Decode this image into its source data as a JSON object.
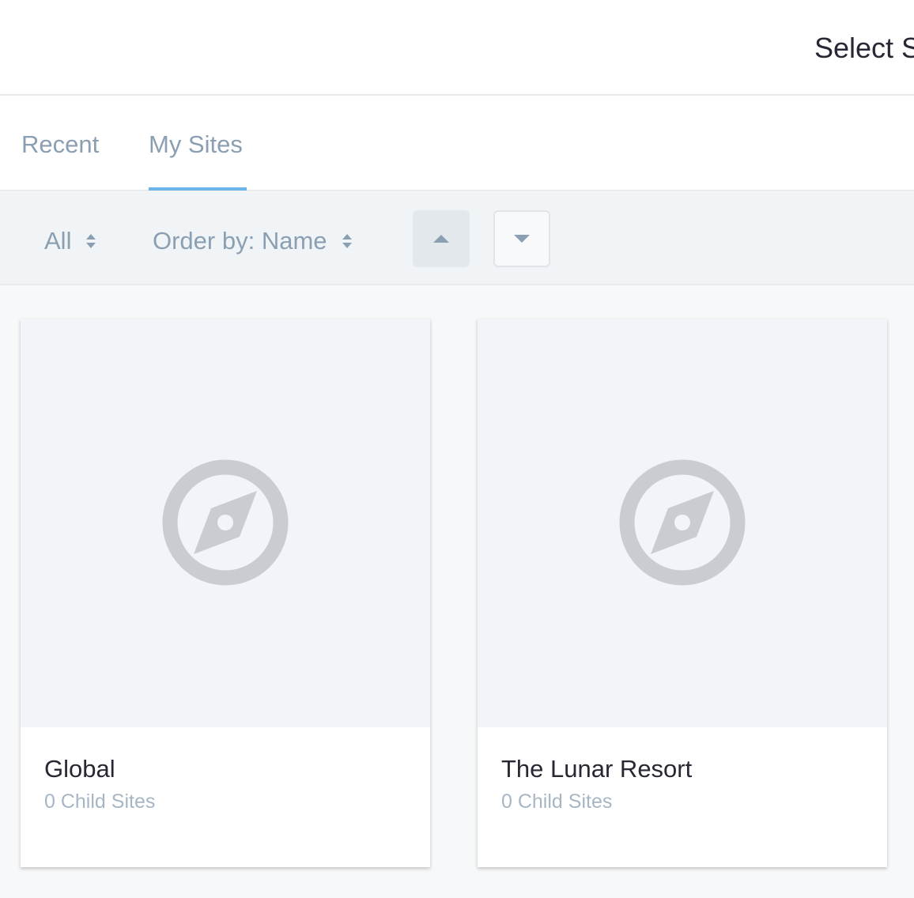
{
  "header": {
    "title": "Select S"
  },
  "tabs": [
    {
      "label": "Recent",
      "active": false
    },
    {
      "label": "My Sites",
      "active": true
    }
  ],
  "toolbar": {
    "filter_label": "All",
    "order_label": "Order by: Name",
    "sort_ascending_icon": "triangle-up-icon",
    "sort_descending_icon": "triangle-down-icon"
  },
  "sites": [
    {
      "name": "Global",
      "child_count": "0 Child Sites",
      "icon": "compass-icon"
    },
    {
      "name": "The Lunar Resort",
      "child_count": "0 Child Sites",
      "icon": "compass-icon"
    }
  ],
  "colors": {
    "accent": "#6cb5ea",
    "muted_text": "#8b9fb2",
    "icon": "#c9cdd2"
  }
}
